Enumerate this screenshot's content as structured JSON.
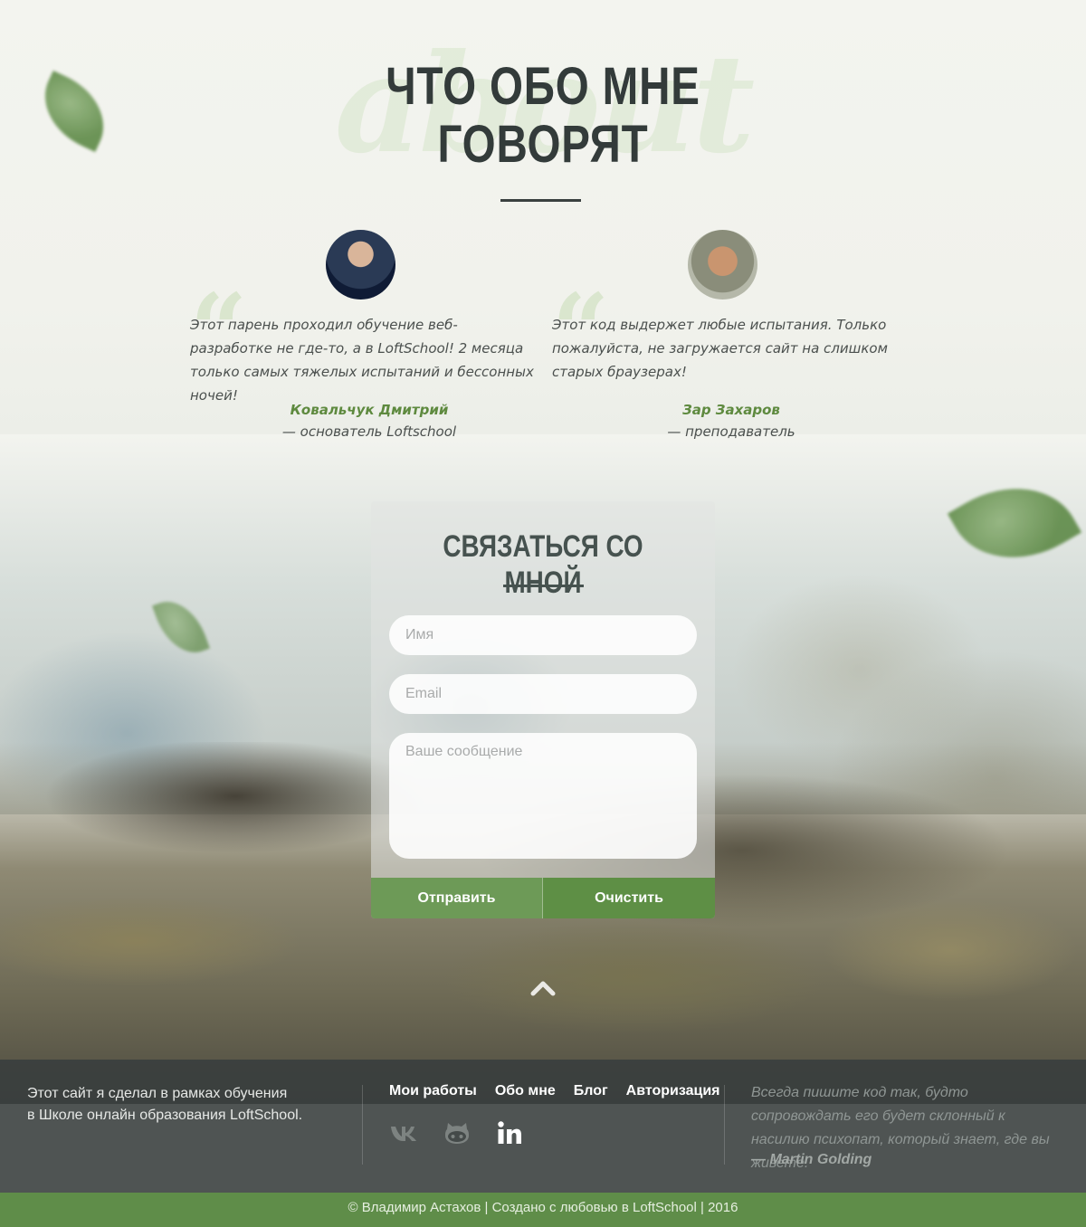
{
  "reviews": {
    "watermark": "about",
    "title_line1": "ЧТО ОБО МНЕ",
    "title_line2": "ГОВОРЯТ",
    "items": [
      {
        "text": "Этот парень проходил обучение веб-разработке не где-то, а в LoftSchool! 2 месяца только самых тяжелых испытаний и бессонных ночей!",
        "author": "Ковальчук Дмитрий",
        "position": "— основатель Loftschool"
      },
      {
        "text": "Этот код выдержет любые испытания. Только пожалуйста, не загружается сайт на слишком старых браузерах!",
        "author": "Зар Захаров",
        "position": "— преподаватель"
      }
    ]
  },
  "contact": {
    "title": "СВЯЗАТЬСЯ СО МНОЙ",
    "name_placeholder": "Имя",
    "email_placeholder": "Email",
    "message_placeholder": "Ваше сообщение",
    "send_label": "Отправить",
    "clear_label": "Очистить"
  },
  "footer": {
    "about_line1": "Этот сайт я сделал в рамках обучения",
    "about_line2": "в Школе онлайн образования LoftSchool.",
    "nav": [
      "Мои работы",
      "Обо мне",
      "Блог",
      "Авторизация"
    ],
    "socials": [
      "vk-icon",
      "github-icon",
      "linkedin-icon"
    ],
    "quote": "Всегда пишите код так, будто сопровождать его будет склонный к насилию психопат, который знает, где вы живете.",
    "quote_author": "— Martin Golding",
    "copyright": "© Владимир Астахов | Создано с любовью в LoftSchool | 2016"
  },
  "colors": {
    "accent_green": "#5e8f45",
    "title_dark": "#333b3a",
    "footer_bg": "#383e3e",
    "copyright_bg": "#5f8d49"
  }
}
